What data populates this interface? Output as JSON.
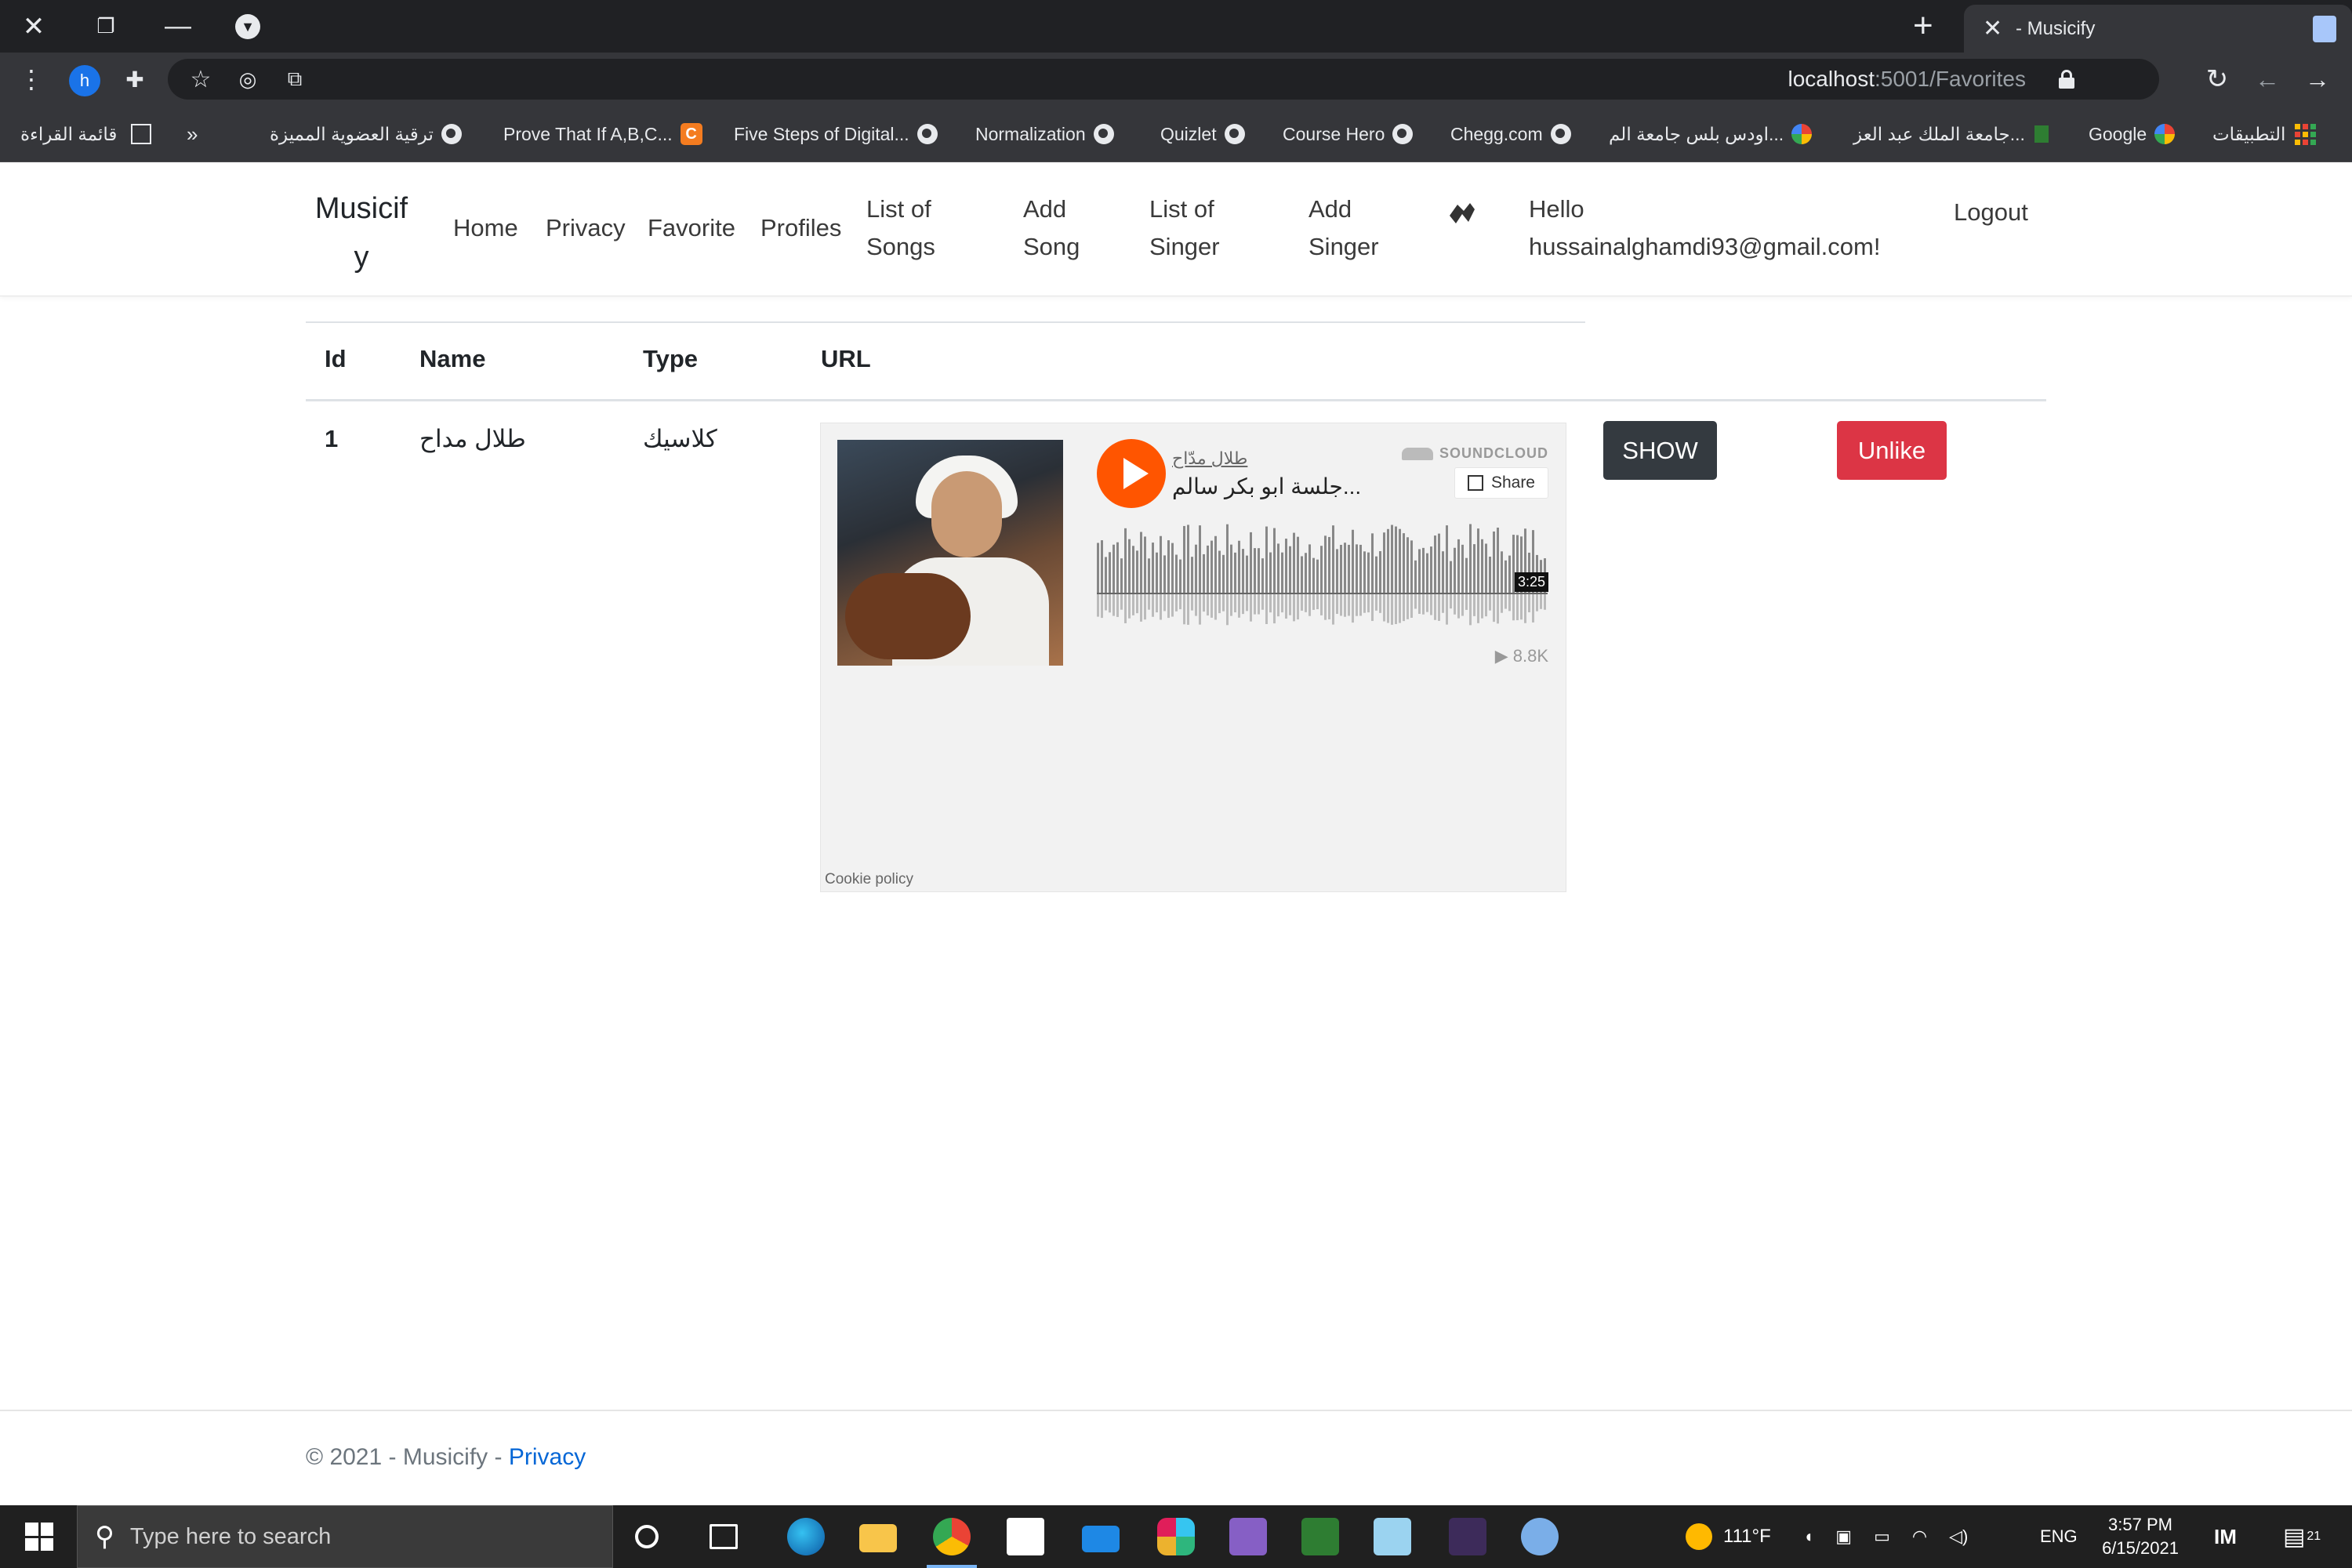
{
  "browser": {
    "tab_title": "- Musicify",
    "url_host": "localhost",
    "url_path": ":5001/Favorites",
    "profile_initial": "h",
    "bookmarks": [
      "قائمة القراءة",
      "»",
      "ترقية العضوية المميزة",
      "Prove That If A,B,C...",
      "Five Steps of Digital...",
      "Normalization",
      "Quizlet",
      "Course Hero",
      "Chegg.com",
      "اودس بلس جامعة الم...",
      "جامعة الملك عبد العز...",
      "Google",
      "التطبيقات"
    ]
  },
  "nav": {
    "brand": "Musicify",
    "links": [
      "Home",
      "Privacy",
      "Favorite",
      "Profiles",
      "List of Songs",
      "Add Song",
      "List of Singer",
      "Add Singer"
    ],
    "greeting": "Hello hussainalghamdi93@gmail.com!",
    "logout": "Logout"
  },
  "table": {
    "headers": [
      "Id",
      "Name",
      "Type",
      "URL"
    ],
    "rows": [
      {
        "id": "1",
        "name": "طلال مداح",
        "type": "كلاسيك",
        "embed": {
          "artist": "طلال مدّاح",
          "title": "جلسة ابو بكر سالم...",
          "brand": "SOUNDCLOUD",
          "share": "Share",
          "duration": "3:25",
          "plays": "8.8K",
          "cookie": "Cookie policy"
        },
        "show_label": "SHOW",
        "unlike_label": "Unlike"
      }
    ]
  },
  "footer": {
    "copyright": "© 2021 - Musicify - ",
    "privacy_link": "Privacy"
  },
  "taskbar": {
    "search_placeholder": "Type here to search",
    "weather": "111°F",
    "language": "ENG",
    "time": "3:57 PM",
    "date": "6/15/2021",
    "notifications": "21"
  },
  "colors": {
    "show_button": "#343a40",
    "unlike_button": "#dc3545",
    "soundcloud_orange": "#ff5500",
    "link_blue": "#0366d6"
  }
}
